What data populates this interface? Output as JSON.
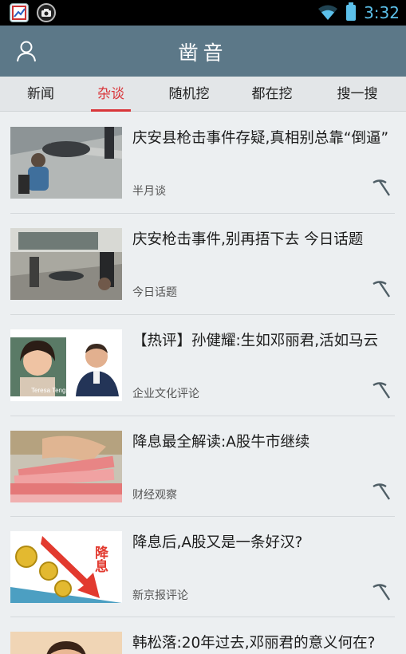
{
  "status_bar": {
    "time": "3:32",
    "icons": [
      "app-shortcut-icon",
      "camera-app-icon",
      "wifi-icon",
      "battery-icon"
    ]
  },
  "app_bar": {
    "title": "凿音",
    "left_icon": "user-icon"
  },
  "tabs": [
    {
      "label": "新闻",
      "active": false
    },
    {
      "label": "杂谈",
      "active": true
    },
    {
      "label": "随机挖",
      "active": false
    },
    {
      "label": "都在挖",
      "active": false
    },
    {
      "label": "搜一搜",
      "active": false
    }
  ],
  "accent_color": "#d9363a",
  "header_color": "#5c7888",
  "articles": [
    {
      "title": "庆安县枪击事件存疑,真相别总靠“倒逼”",
      "source": "半月谈",
      "icon": "pickaxe-icon"
    },
    {
      "title": "庆安枪击事件,别再捂下去   今日话题",
      "source": "今日话题",
      "icon": "pickaxe-icon"
    },
    {
      "title": "【热评】孙健耀:生如邓丽君,活如马云",
      "source": "企业文化评论",
      "icon": "pickaxe-icon"
    },
    {
      "title": "降息最全解读:A股牛市继续",
      "source": "财经观察",
      "icon": "pickaxe-icon"
    },
    {
      "title": "降息后,A股又是一条好汉?",
      "source": "新京报评论",
      "icon": "pickaxe-icon"
    },
    {
      "title": "韩松落:20年过去,邓丽君的意义何在?",
      "source": "",
      "icon": "pickaxe-icon"
    }
  ],
  "thumb_texts": {
    "teresa": "Teresa Teng",
    "rate_cut": "降息"
  }
}
